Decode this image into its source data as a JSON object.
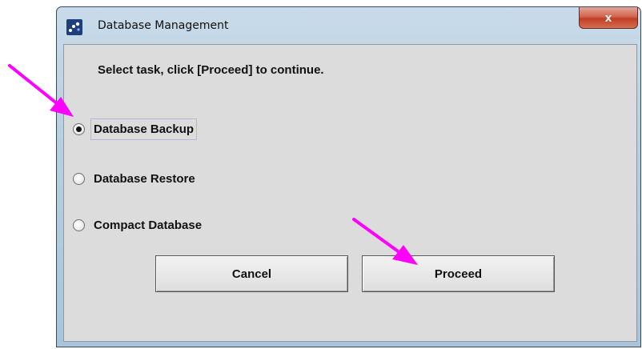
{
  "window": {
    "title": "Database Management",
    "app_icon": "java-dots-icon",
    "close_label": "x"
  },
  "dialog": {
    "instruction": "Select task, click [Proceed] to continue.",
    "options": [
      {
        "label": "Database Backup",
        "selected": true
      },
      {
        "label": "Database Restore",
        "selected": false
      },
      {
        "label": "Compact Database",
        "selected": false
      }
    ],
    "cancel_label": "Cancel",
    "proceed_label": "Proceed"
  },
  "annotations": {
    "arrow_color": "#ff00ff",
    "arrows": [
      "pointer-arrow-backup",
      "pointer-arrow-proceed"
    ]
  }
}
